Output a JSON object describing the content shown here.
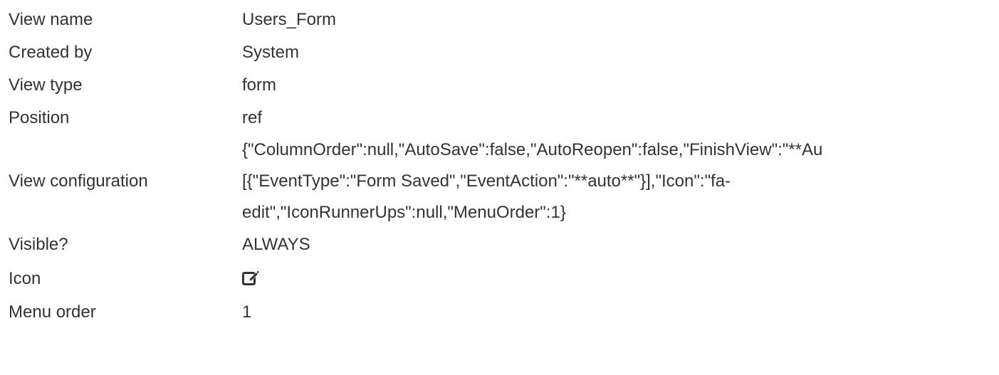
{
  "props": {
    "view_name": {
      "label": "View name",
      "value": "Users_Form"
    },
    "created_by": {
      "label": "Created by",
      "value": "System"
    },
    "view_type": {
      "label": "View type",
      "value": "form"
    },
    "position": {
      "label": "Position",
      "value": "ref"
    },
    "view_configuration": {
      "label": "View configuration",
      "lines": [
        "{\"ColumnOrder\":null,\"AutoSave\":false,\"AutoReopen\":false,\"FinishView\":\"**Au",
        "[{\"EventType\":\"Form Saved\",\"EventAction\":\"**auto**\"}],\"Icon\":\"fa-",
        "edit\",\"IconRunnerUps\":null,\"MenuOrder\":1}"
      ]
    },
    "visible": {
      "label": "Visible?",
      "value": "ALWAYS"
    },
    "icon": {
      "label": "Icon",
      "icon_name": "edit-icon"
    },
    "menu_order": {
      "label": "Menu order",
      "value": "1"
    }
  }
}
